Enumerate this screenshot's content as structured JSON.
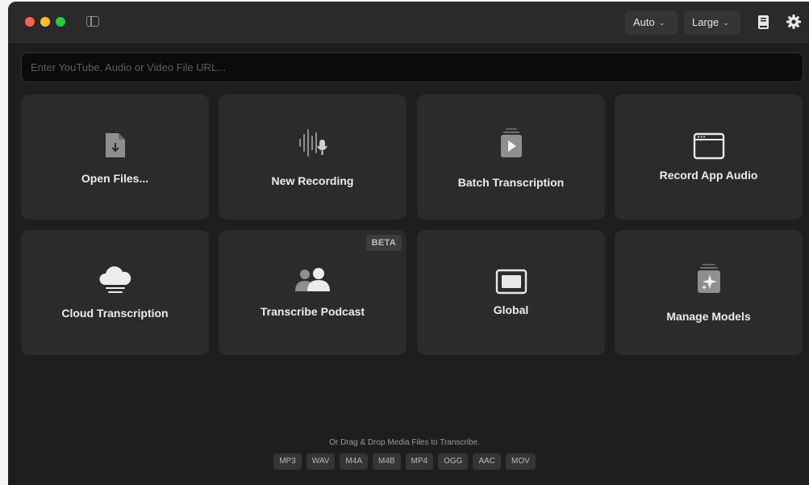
{
  "toolbar": {
    "language": {
      "value": "Auto"
    },
    "model_size": {
      "value": "Large"
    }
  },
  "url_input": {
    "placeholder": "Enter YouTube, Audio or Video File URL..."
  },
  "cards": [
    {
      "label": "Open Files...",
      "icon": "file-download-icon"
    },
    {
      "label": "New Recording",
      "icon": "waveform-mic-icon"
    },
    {
      "label": "Batch Transcription",
      "icon": "stacked-play-icon"
    },
    {
      "label": "Record App Audio",
      "icon": "app-window-icon"
    },
    {
      "label": "Cloud Transcription",
      "icon": "cloud-icon"
    },
    {
      "label": "Transcribe Podcast",
      "icon": "people-icon",
      "badge": "BETA"
    },
    {
      "label": "Global",
      "icon": "display-icon"
    },
    {
      "label": "Manage Models",
      "icon": "sparkle-stack-icon"
    }
  ],
  "footer": {
    "hint": "Or Drag & Drop Media Files to Transcribe.",
    "formats": [
      "MP3",
      "WAV",
      "M4A",
      "M4B",
      "MP4",
      "OGG",
      "AAC",
      "MOV"
    ]
  },
  "colors": {
    "window_bg": "#1e1e1e",
    "card_bg": "#2b2b2b",
    "text": "#ececec"
  }
}
